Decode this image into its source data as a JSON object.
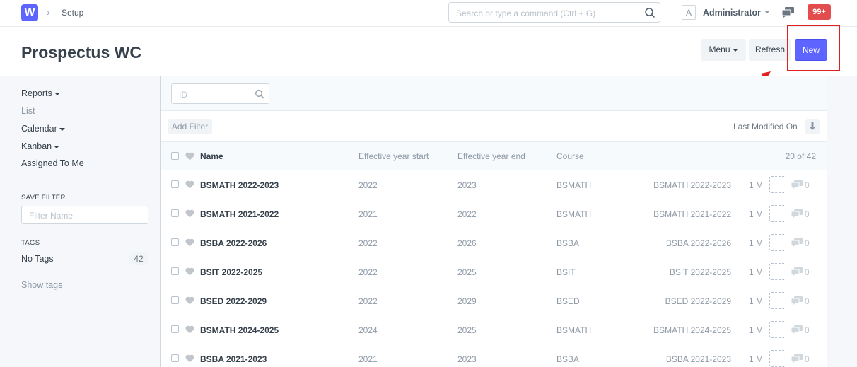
{
  "navbar": {
    "logo_letter": "W",
    "breadcrumb": "Setup",
    "search_placeholder": "Search or type a command (Ctrl + G)",
    "avatar_letter": "A",
    "user_name": "Administrator",
    "notifications": "99+"
  },
  "page": {
    "title": "Prospectus WC",
    "menu_label": "Menu",
    "refresh_label": "Refresh",
    "new_label": "New"
  },
  "sidebar": {
    "reports": "Reports",
    "list": "List",
    "calendar": "Calendar",
    "kanban": "Kanban",
    "assigned": "Assigned To Me",
    "save_filter_heading": "SAVE FILTER",
    "filter_name_placeholder": "Filter Name",
    "tags_heading": "TAGS",
    "no_tags": "No Tags",
    "no_tags_count": "42",
    "show_tags": "Show tags"
  },
  "list": {
    "id_placeholder": "ID",
    "add_filter": "Add Filter",
    "sort_label": "Last Modified On",
    "columns": {
      "name": "Name",
      "start": "Effective year start",
      "end": "Effective year end",
      "course": "Course",
      "count": "20 of 42"
    },
    "rows": [
      {
        "name": "BSMATH 2022-2023",
        "start": "2022",
        "end": "2023",
        "course": "BSMATH",
        "title": "BSMATH 2022-2023",
        "modified": "1 M",
        "comments": "0"
      },
      {
        "name": "BSMATH 2021-2022",
        "start": "2021",
        "end": "2022",
        "course": "BSMATH",
        "title": "BSMATH 2021-2022",
        "modified": "1 M",
        "comments": "0"
      },
      {
        "name": "BSBA 2022-2026",
        "start": "2022",
        "end": "2026",
        "course": "BSBA",
        "title": "BSBA 2022-2026",
        "modified": "1 M",
        "comments": "0"
      },
      {
        "name": "BSIT 2022-2025",
        "start": "2022",
        "end": "2025",
        "course": "BSIT",
        "title": "BSIT 2022-2025",
        "modified": "1 M",
        "comments": "0"
      },
      {
        "name": "BSED 2022-2029",
        "start": "2022",
        "end": "2029",
        "course": "BSED",
        "title": "BSED 2022-2029",
        "modified": "1 M",
        "comments": "0"
      },
      {
        "name": "BSMATH 2024-2025",
        "start": "2024",
        "end": "2025",
        "course": "BSMATH",
        "title": "BSMATH 2024-2025",
        "modified": "1 M",
        "comments": "0"
      },
      {
        "name": "BSBA 2021-2023",
        "start": "2021",
        "end": "2023",
        "course": "BSBA",
        "title": "BSBA 2021-2023",
        "modified": "1 M",
        "comments": "0"
      }
    ]
  },
  "colors": {
    "primary": "#5e64ff",
    "highlight": "#e02020",
    "badge": "#e24c4c"
  }
}
